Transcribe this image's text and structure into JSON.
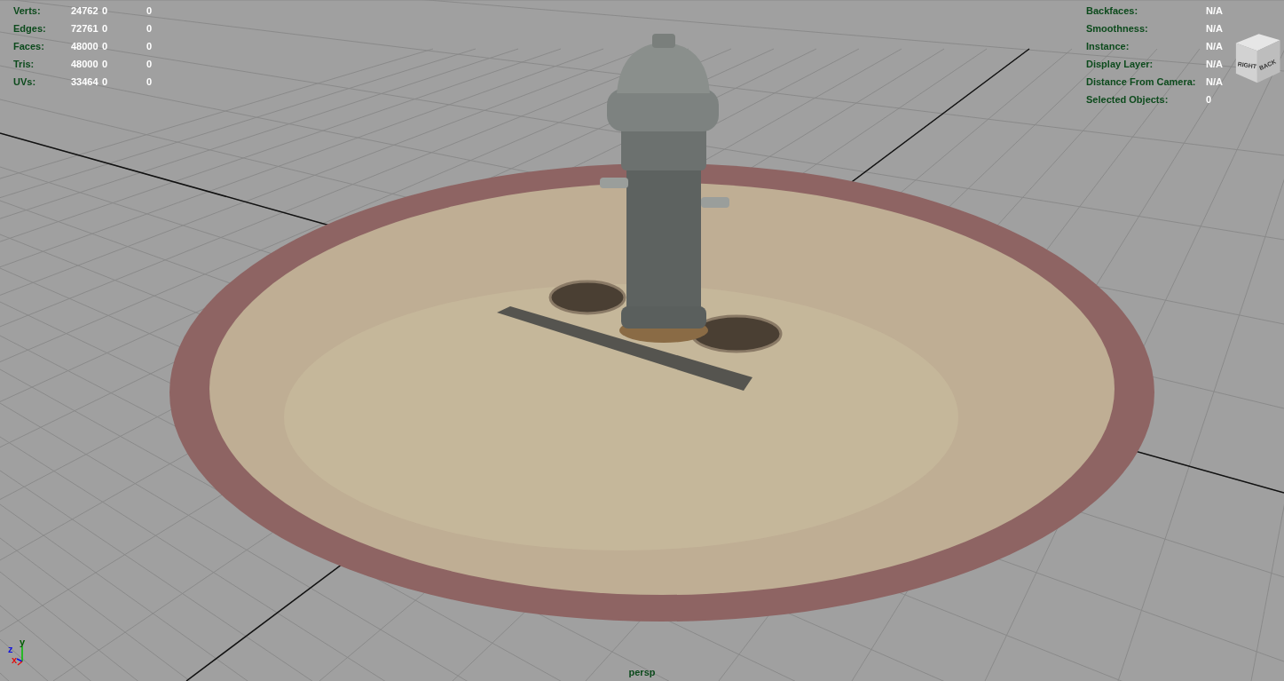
{
  "hud_left": [
    {
      "label": "Verts:",
      "values": [
        "24762",
        "0",
        "0"
      ]
    },
    {
      "label": "Edges:",
      "values": [
        "72761",
        "0",
        "0"
      ]
    },
    {
      "label": "Faces:",
      "values": [
        "48000",
        "0",
        "0"
      ]
    },
    {
      "label": "Tris:",
      "values": [
        "48000",
        "0",
        "0"
      ]
    },
    {
      "label": "UVs:",
      "values": [
        "33464",
        "0",
        "0"
      ]
    }
  ],
  "hud_right": [
    {
      "label": "Backfaces:",
      "value": "N/A"
    },
    {
      "label": "Smoothness:",
      "value": "N/A"
    },
    {
      "label": "Instance:",
      "value": "N/A"
    },
    {
      "label": "Display Layer:",
      "value": "N/A"
    },
    {
      "label": "Distance From Camera:",
      "value": "N/A"
    },
    {
      "label": "Selected Objects:",
      "value": "0"
    }
  ],
  "view_cube": {
    "faces": [
      "RIGHT",
      "BACK"
    ]
  },
  "axis_gizmo": {
    "labels": [
      "z",
      "y",
      "x"
    ]
  },
  "viewport": {
    "camera": "persp"
  }
}
